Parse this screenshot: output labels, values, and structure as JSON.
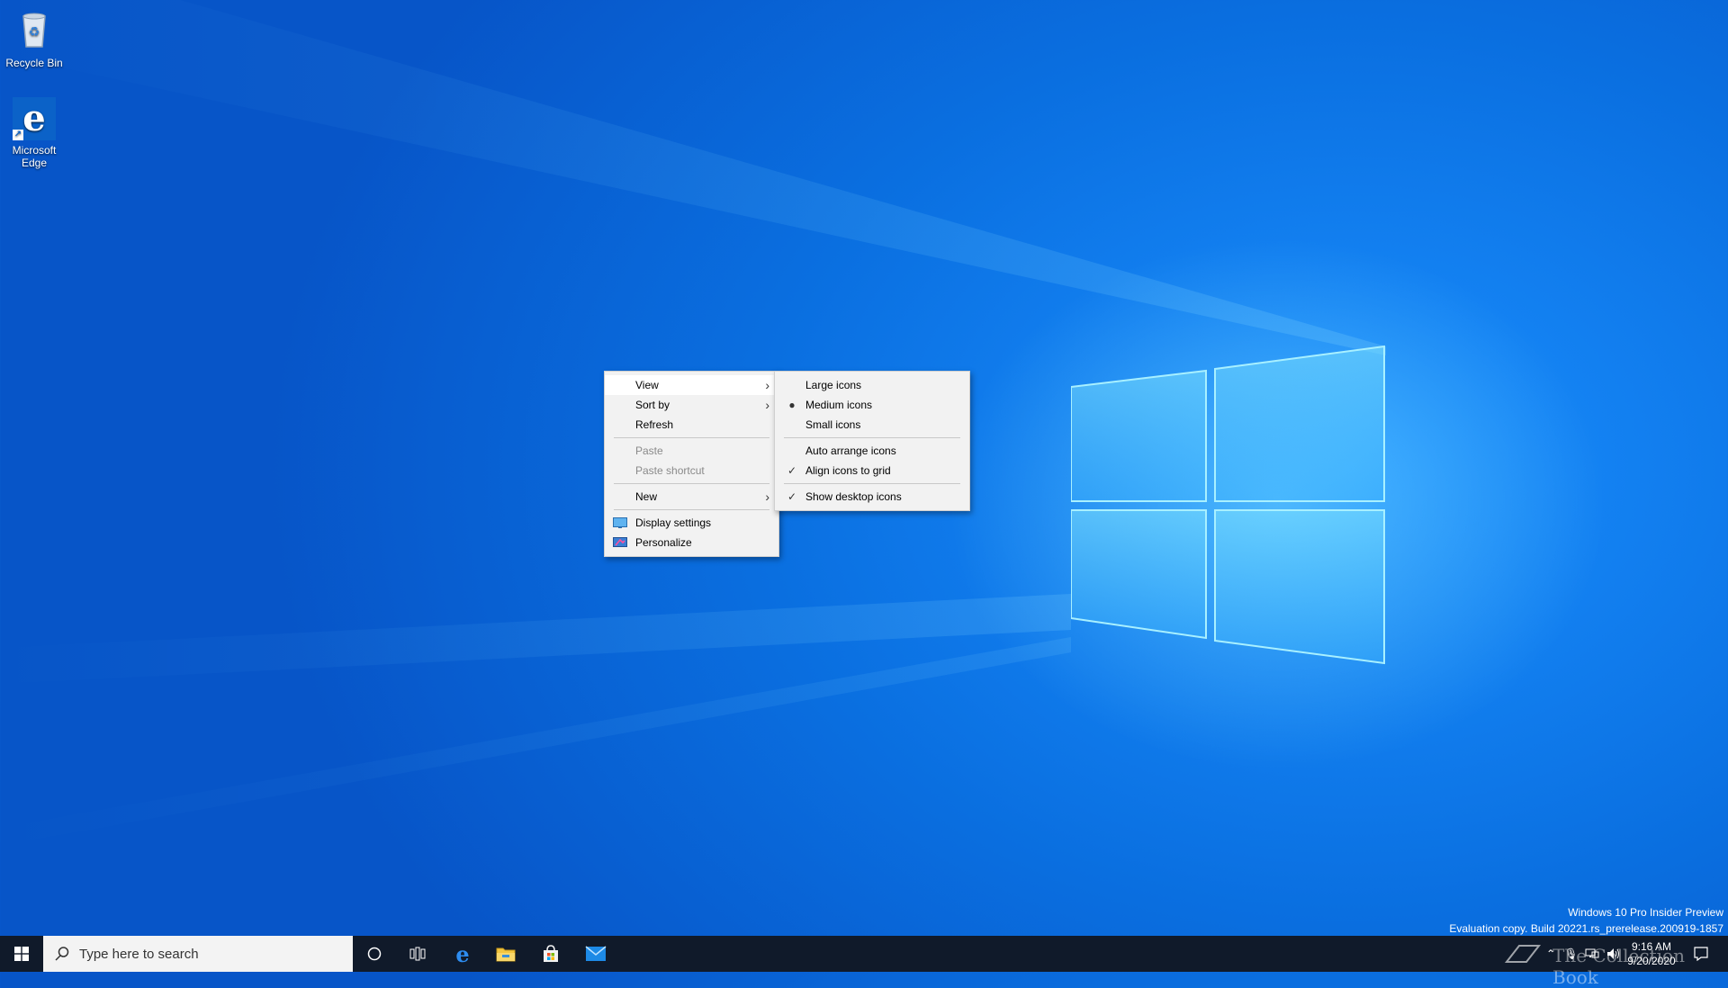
{
  "desktop": {
    "icons": [
      {
        "label": "Recycle Bin"
      },
      {
        "label": "Microsoft Edge"
      }
    ]
  },
  "context_menu": {
    "items": [
      {
        "label": "View",
        "submenu": true,
        "highlighted": true
      },
      {
        "label": "Sort by",
        "submenu": true
      },
      {
        "label": "Refresh"
      },
      {
        "label": "Paste",
        "disabled": true
      },
      {
        "label": "Paste shortcut",
        "disabled": true
      },
      {
        "label": "New",
        "submenu": true
      },
      {
        "label": "Display settings",
        "icon": "display-settings-icon"
      },
      {
        "label": "Personalize",
        "icon": "personalize-icon"
      }
    ]
  },
  "view_submenu": {
    "items": [
      {
        "label": "Large icons"
      },
      {
        "label": "Medium icons",
        "selected": true
      },
      {
        "label": "Small icons"
      },
      {
        "label": "Auto arrange icons"
      },
      {
        "label": "Align icons to grid",
        "checked": true
      },
      {
        "label": "Show desktop icons",
        "checked": true
      }
    ]
  },
  "watermark": {
    "line1": "Windows 10 Pro Insider Preview",
    "line2": "Evaluation copy. Build 20221.rs_prerelease.200919-1857"
  },
  "taskbar": {
    "search_placeholder": "Type here to search",
    "clock_time": "9:16 AM",
    "clock_date": "9/20/2020",
    "watermark_overlay": "The Collection Book"
  },
  "colors": {
    "desktop_blue": "#0a6fe0",
    "taskbar": "#101a2a",
    "menu_bg": "#f2f2f2"
  }
}
